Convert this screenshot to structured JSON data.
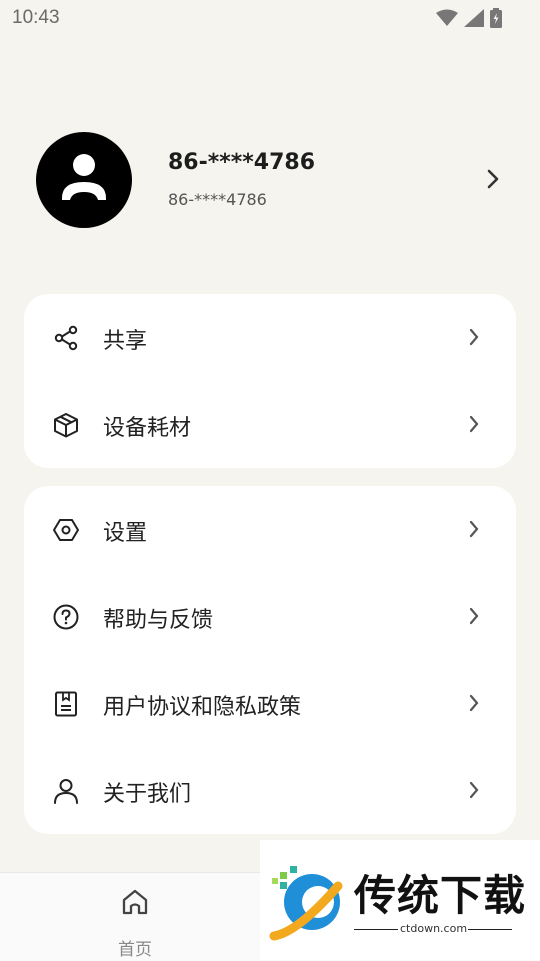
{
  "status_bar": {
    "time": "10:43"
  },
  "profile": {
    "name": "86-****4786",
    "account": "86-****4786"
  },
  "group1": [
    {
      "label": "共享",
      "icon": "share-icon"
    },
    {
      "label": "设备耗材",
      "icon": "box-icon"
    }
  ],
  "group2": [
    {
      "label": "设置",
      "icon": "settings-icon"
    },
    {
      "label": "帮助与反馈",
      "icon": "help-icon"
    },
    {
      "label": "用户协议和隐私政策",
      "icon": "document-icon"
    },
    {
      "label": "关于我们",
      "icon": "person-icon"
    }
  ],
  "bottom_nav": {
    "home_label": "首页"
  },
  "watermark": {
    "title": "传统下载",
    "url": "ctdown.com"
  }
}
